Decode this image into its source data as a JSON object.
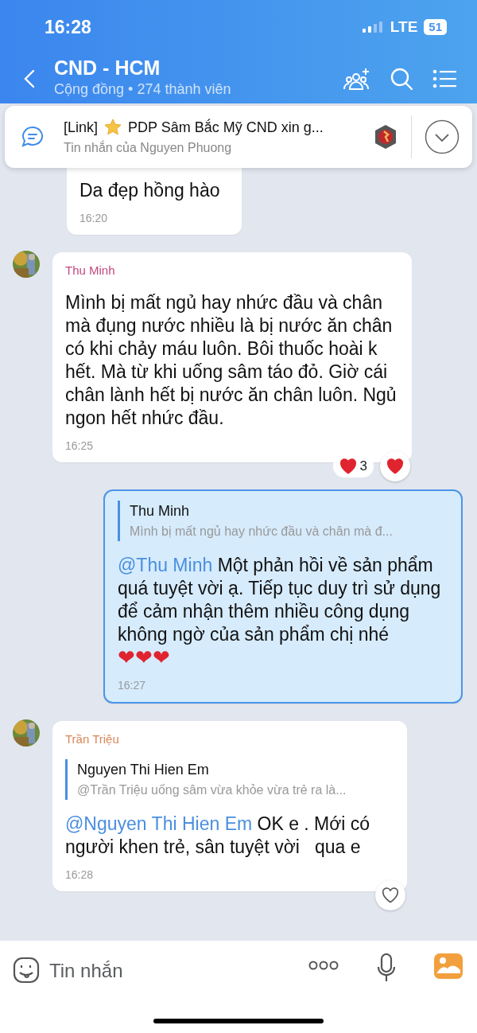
{
  "status_bar": {
    "time": "16:28",
    "network": "LTE",
    "battery": "51"
  },
  "header": {
    "title": "CND - HCM",
    "subtitle": "Cộng đồng • 274 thành viên"
  },
  "pinned": {
    "prefix": "[Link]",
    "title": "PDP Sâm Bắc Mỹ CND xin g...",
    "caption": "Tin nhắn của Nguyen Phuong"
  },
  "messages": [
    {
      "kind": "continuation",
      "text": "Da đẹp hồng hào",
      "time": "16:20"
    },
    {
      "kind": "incoming",
      "sender": "Thu Minh",
      "color": "#c2477f",
      "text": "Mình bị mất ngủ hay nhức đầu và chân mà đụng nước nhiều là bị nước ăn chân có khi chảy máu luôn. Bôi thuốc hoài k hết. Mà từ khi uống sâm táo đỏ. Giờ cái chân lành hết bị nước ăn chân luôn. Ngủ ngon hết nhức đầu.",
      "time": "16:25",
      "reaction_count": "3",
      "reacted": true
    },
    {
      "kind": "outgoing",
      "quote": {
        "author": "Thu Minh",
        "excerpt": "Mình bị mất ngủ hay nhức đầu và chân mà đ..."
      },
      "mention": "@Thu Minh",
      "text": "Một phản hồi về sản phẩm quá tuyệt vời ạ. Tiếp tục duy trì sử dụng để cảm nhận thêm nhiều công dụng không ngờ của sản phẩm chị nhé",
      "emoji": "❤❤❤",
      "time": "16:27"
    },
    {
      "kind": "incoming",
      "sender": "Trần Triệu",
      "color": "#d9875a",
      "quote": {
        "author": "Nguyen Thi Hien Em",
        "excerpt": "@Trần Triệu uống sâm vừa khỏe vừa trẻ ra là..."
      },
      "mention": "@Nguyen Thi Hien Em",
      "text": "OK e . Mới có người khen trẻ, sân tuyệt vời   qua e",
      "time": "16:28",
      "reacted": false
    }
  ],
  "composer": {
    "placeholder": "Tin nhắn"
  }
}
